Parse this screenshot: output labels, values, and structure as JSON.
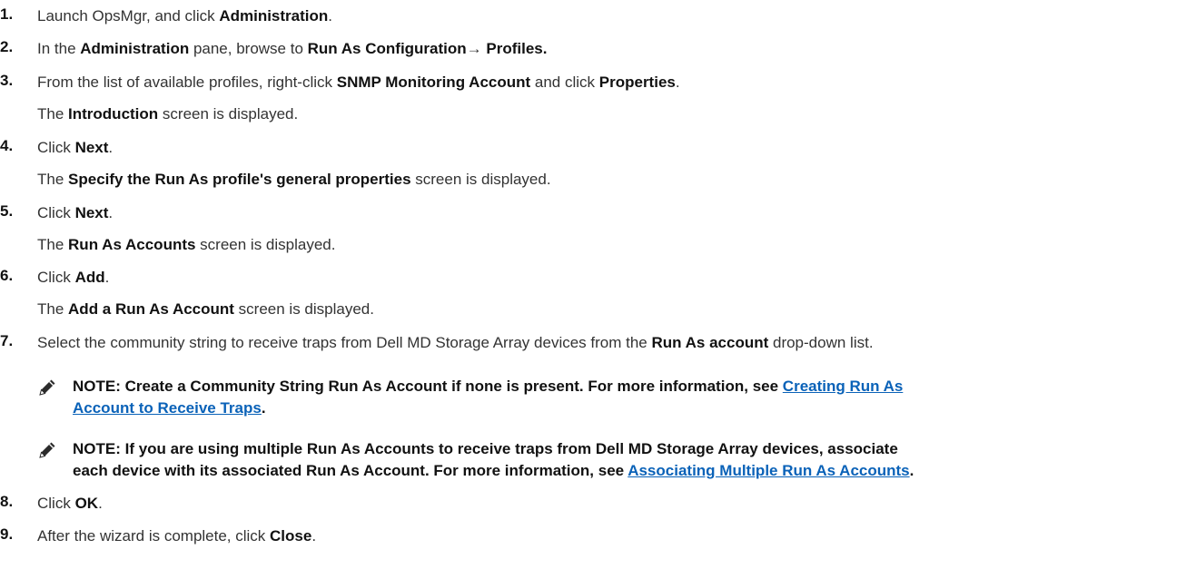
{
  "steps": [
    {
      "num": "1.",
      "parts": [
        "Launch OpsMgr, and click ",
        "Administration",
        "."
      ]
    },
    {
      "num": "2.",
      "parts": [
        "In the ",
        "Administration",
        " pane, browse to ",
        "Run As Configuration",
        "→ ",
        "Profiles."
      ]
    },
    {
      "num": "3.",
      "parts": [
        "From the list of available profiles, right-click ",
        "SNMP Monitoring Account",
        " and click ",
        "Properties",
        "."
      ],
      "result": [
        "The ",
        "Introduction",
        " screen is displayed."
      ]
    },
    {
      "num": "4.",
      "parts": [
        "Click ",
        "Next",
        "."
      ],
      "result": [
        "The ",
        "Specify the Run As profile's general properties",
        " screen is displayed."
      ]
    },
    {
      "num": "5.",
      "parts": [
        "Click ",
        "Next",
        "."
      ],
      "result": [
        "The ",
        "Run As Accounts",
        " screen is displayed."
      ]
    },
    {
      "num": "6.",
      "parts": [
        "Click ",
        "Add",
        "."
      ],
      "result": [
        "The ",
        "Add a Run As Account",
        " screen is displayed."
      ]
    },
    {
      "num": "7.",
      "parts": [
        "Select the community string to receive traps from Dell MD Storage Array devices from the ",
        "Run As account",
        " drop-down list."
      ]
    },
    {
      "num": "8.",
      "parts": [
        "Click ",
        "OK",
        "."
      ]
    },
    {
      "num": "9.",
      "parts": [
        "After the wizard is complete, click ",
        "Close",
        "."
      ]
    }
  ],
  "notes": [
    {
      "icon": "note-pencil-icon",
      "line1": "NOTE: Create a Community String Run As Account if none is present. For more information, see ",
      "link1": "Creating Run As",
      "link2": "Account to Receive Traps",
      "tail": "."
    },
    {
      "icon": "note-pencil-icon",
      "line1": "NOTE: If you are using multiple Run As Accounts to receive traps from Dell MD Storage Array devices, associate",
      "line2": "each device with its associated Run As Account. For more information, see ",
      "link": "Associating Multiple Run As Accounts",
      "tail": "."
    }
  ]
}
